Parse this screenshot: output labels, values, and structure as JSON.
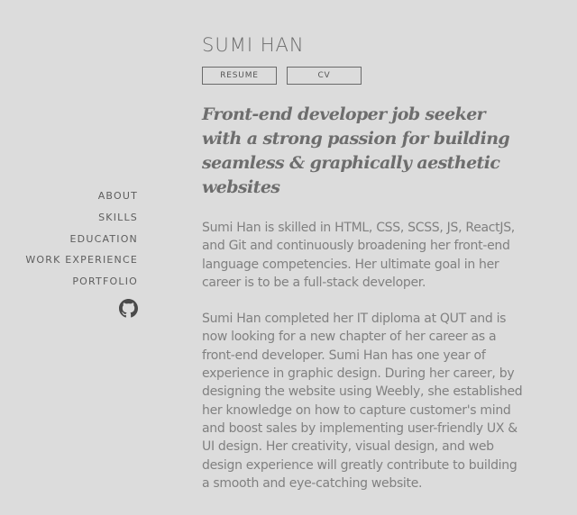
{
  "profile": {
    "name": "SUMI HAN",
    "tagline": "Front-end developer job seeker with a strong passion for building seamless & graphically aesthetic websites",
    "paragraphs": [
      "Sumi Han is skilled in HTML, CSS, SCSS, JS, ReactJS, and Git and continuously broadening her front-end language competencies. Her ultimate goal in her career is to be a full-stack developer.",
      "Sumi Han completed her IT diploma at QUT and is now looking for a new chapter of her career as a front-end developer. Sumi Han has one year of experience in graphic design. During her career, by designing the website using Weebly, she established her knowledge on how to capture customer's mind and boost sales by implementing user-friendly UX & UI design. Her creativity, visual design, and web design experience will greatly contribute to building a smooth and eye-catching website."
    ]
  },
  "buttons": {
    "resume": "RESUME",
    "cv": "CV"
  },
  "nav": {
    "items": [
      "ABOUT",
      "SKILLS",
      "EDUCATION",
      "WORK EXPERIENCE",
      "PORTFOLIO"
    ],
    "github_icon": "github-icon"
  },
  "colors": {
    "background": "#dcdcdc",
    "text": "#808080",
    "heading": "#6b6b6b"
  }
}
